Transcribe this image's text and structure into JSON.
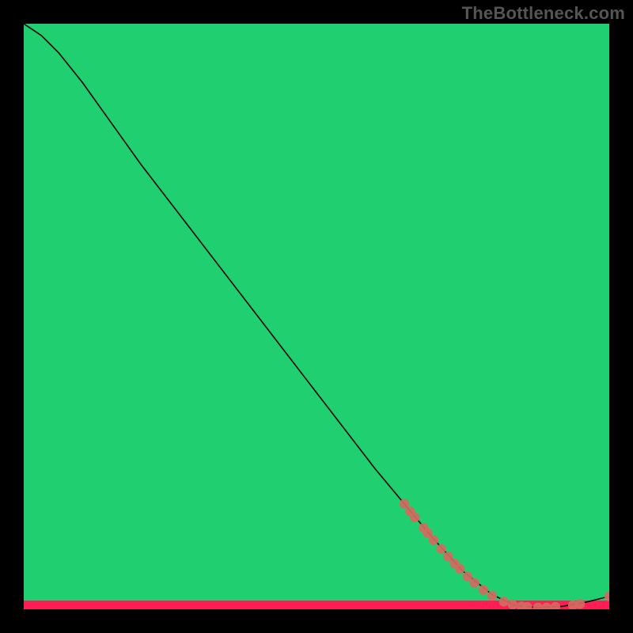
{
  "watermark": "TheBottleneck.com",
  "chart_data": {
    "type": "line",
    "title": "",
    "xlabel": "",
    "ylabel": "",
    "xlim": [
      0,
      100
    ],
    "ylim": [
      0,
      100
    ],
    "grid": false,
    "legend": false,
    "background_bands": [
      {
        "y0": 0,
        "y1": 3,
        "color": "#20d070"
      },
      {
        "y0": 3,
        "y1": 6,
        "color": "#7fe060"
      },
      {
        "y0": 6,
        "y1": 10,
        "color": "#c8f050"
      },
      {
        "y0": 10,
        "y1": 18,
        "color": "#f5f84a"
      },
      {
        "y0": 18,
        "y1": 28,
        "color": "#ffe345"
      },
      {
        "y0": 28,
        "y1": 40,
        "color": "#ffc43a"
      },
      {
        "y0": 40,
        "y1": 55,
        "color": "#ff9a38"
      },
      {
        "y0": 55,
        "y1": 72,
        "color": "#ff6a3a"
      },
      {
        "y0": 72,
        "y1": 88,
        "color": "#ff3d45"
      },
      {
        "y0": 88,
        "y1": 100,
        "color": "#ff1d55"
      }
    ],
    "series": [
      {
        "name": "curve",
        "style": "line",
        "color": "#000000",
        "width": 1.6,
        "points": [
          {
            "x": 0,
            "y": 100
          },
          {
            "x": 3,
            "y": 98
          },
          {
            "x": 6,
            "y": 95
          },
          {
            "x": 10,
            "y": 90
          },
          {
            "x": 15,
            "y": 83
          },
          {
            "x": 20,
            "y": 76
          },
          {
            "x": 30,
            "y": 63
          },
          {
            "x": 40,
            "y": 50
          },
          {
            "x": 50,
            "y": 37
          },
          {
            "x": 60,
            "y": 24
          },
          {
            "x": 65,
            "y": 18
          },
          {
            "x": 70,
            "y": 12
          },
          {
            "x": 75,
            "y": 6.5
          },
          {
            "x": 80,
            "y": 2.5
          },
          {
            "x": 84,
            "y": 0.6
          },
          {
            "x": 88,
            "y": 0.3
          },
          {
            "x": 92,
            "y": 0.5
          },
          {
            "x": 96,
            "y": 1.2
          },
          {
            "x": 100,
            "y": 2.2
          }
        ]
      },
      {
        "name": "markers",
        "style": "scatter",
        "color": "#d46a5f",
        "radius": 6.2,
        "points": [
          {
            "x": 65,
            "y": 18.0
          },
          {
            "x": 66,
            "y": 16.7
          },
          {
            "x": 66.8,
            "y": 15.7
          },
          {
            "x": 68.3,
            "y": 13.9
          },
          {
            "x": 69.0,
            "y": 13.0
          },
          {
            "x": 70.0,
            "y": 11.8
          },
          {
            "x": 71.3,
            "y": 10.3
          },
          {
            "x": 72.5,
            "y": 9.0
          },
          {
            "x": 73.6,
            "y": 7.8
          },
          {
            "x": 74.5,
            "y": 6.9
          },
          {
            "x": 75.8,
            "y": 5.6
          },
          {
            "x": 77.0,
            "y": 4.5
          },
          {
            "x": 78.5,
            "y": 3.3
          },
          {
            "x": 80.0,
            "y": 2.3
          },
          {
            "x": 82.0,
            "y": 1.3
          },
          {
            "x": 83.5,
            "y": 0.8
          },
          {
            "x": 85.0,
            "y": 0.5
          },
          {
            "x": 86.0,
            "y": 0.4
          },
          {
            "x": 87.8,
            "y": 0.3
          },
          {
            "x": 89.3,
            "y": 0.3
          },
          {
            "x": 90.8,
            "y": 0.4
          },
          {
            "x": 93.8,
            "y": 0.7
          },
          {
            "x": 95.0,
            "y": 0.9
          },
          {
            "x": 100,
            "y": 2.2
          }
        ]
      }
    ]
  }
}
